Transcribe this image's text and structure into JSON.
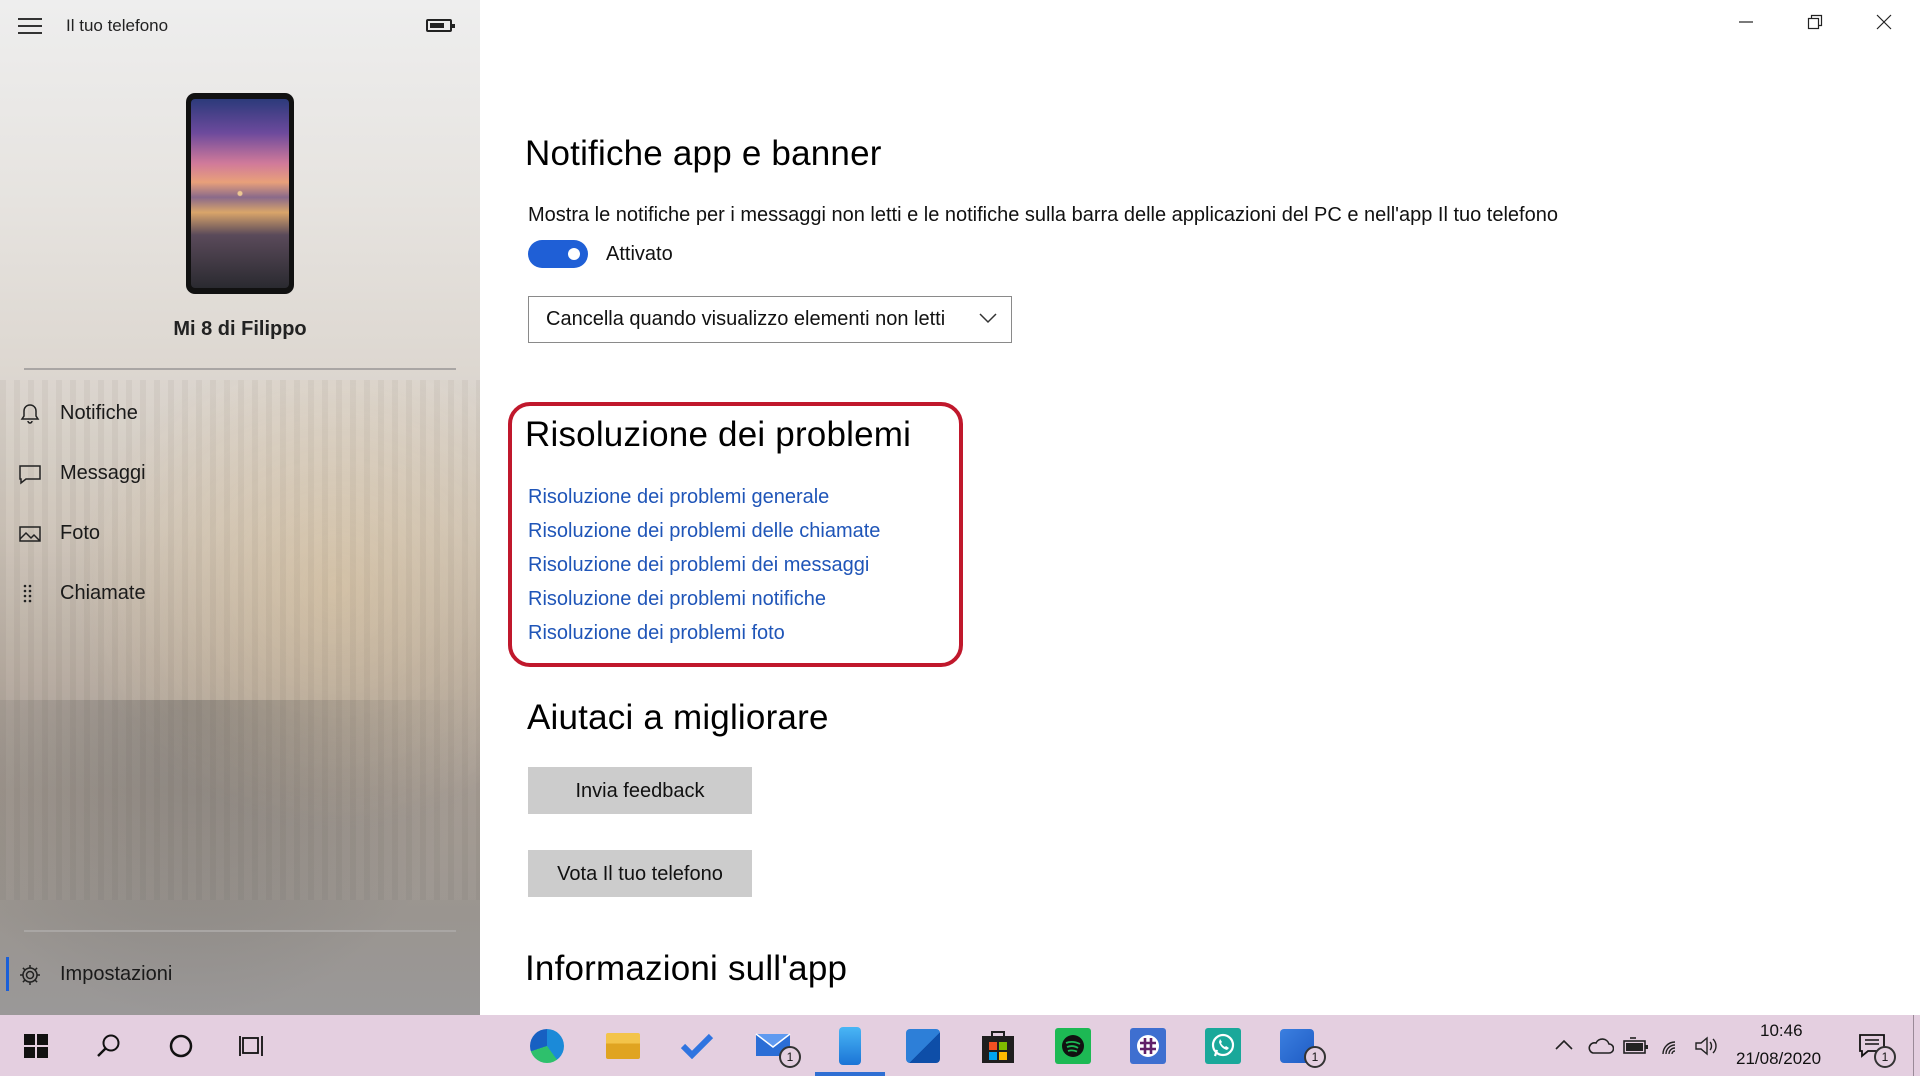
{
  "window": {
    "app_title": "Il tuo telefono",
    "icons": [
      "hamburger-icon",
      "phone-battery-icon",
      "minimize-icon",
      "restore-icon",
      "close-icon"
    ]
  },
  "sidebar": {
    "device_name": "Mi 8 di Filippo",
    "items": [
      {
        "label": "Notifiche",
        "icon": "bell-icon"
      },
      {
        "label": "Messaggi",
        "icon": "message-icon"
      },
      {
        "label": "Foto",
        "icon": "photo-icon"
      },
      {
        "label": "Chiamate",
        "icon": "dialpad-icon"
      }
    ],
    "settings_label": "Impostazioni",
    "settings_icon": "gear-icon"
  },
  "main": {
    "notifications": {
      "title": "Notifiche app e banner",
      "description": "Mostra le notifiche per i messaggi non letti e le notifiche sulla barra delle applicazioni del PC e nell'app Il tuo telefono",
      "toggle_label": "Attivato",
      "toggle_on": true,
      "dropdown_value": "Cancella quando visualizzo elementi non letti"
    },
    "troubleshooting": {
      "title": "Risoluzione dei problemi",
      "links": [
        "Risoluzione dei problemi generale",
        "Risoluzione dei problemi delle chiamate",
        "Risoluzione dei problemi dei messaggi",
        "Risoluzione dei problemi notifiche",
        "Risoluzione dei problemi foto"
      ]
    },
    "improve": {
      "title": "Aiutaci a migliorare",
      "feedback_button": "Invia feedback",
      "rate_button": "Vota Il tuo telefono"
    },
    "about": {
      "title": "Informazioni sull'app"
    }
  },
  "taskbar": {
    "apps": [
      {
        "name": "edge",
        "badge": ""
      },
      {
        "name": "file-explorer",
        "badge": ""
      },
      {
        "name": "todo",
        "badge": ""
      },
      {
        "name": "mail",
        "badge": "1"
      },
      {
        "name": "your-phone",
        "badge": ""
      },
      {
        "name": "photos",
        "badge": ""
      },
      {
        "name": "store",
        "badge": ""
      },
      {
        "name": "spotify",
        "badge": ""
      },
      {
        "name": "slack",
        "badge": ""
      },
      {
        "name": "whatsapp",
        "badge": ""
      },
      {
        "name": "outlook",
        "badge": "1"
      }
    ],
    "time": "10:46",
    "date": "21/08/2020",
    "notification_count": "1",
    "colors": {
      "accent": "#1f5fd6",
      "link": "#1f55b8",
      "highlight": "#c0182c",
      "taskbar": "#e4cfe0"
    }
  }
}
